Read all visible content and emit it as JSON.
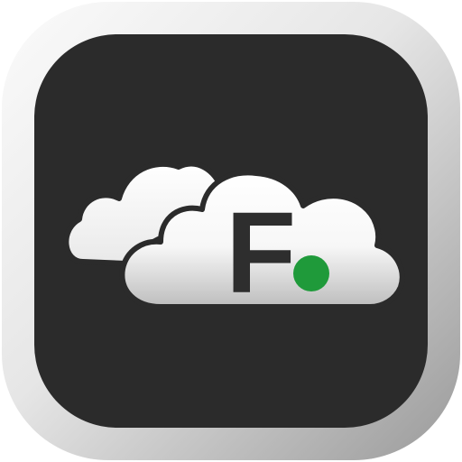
{
  "icon": {
    "name": "cloud-app-icon",
    "logo_letter": "F",
    "colors": {
      "outer_frame_light": "#fbfbfb",
      "outer_frame_dark": "#9a9a9a",
      "tile": "#2b2b2b",
      "cloud": "#ffffff",
      "cloud_shadow": "#bdbdbd",
      "letter": "#2e2e2e",
      "dot": "#1f9a3a"
    }
  }
}
